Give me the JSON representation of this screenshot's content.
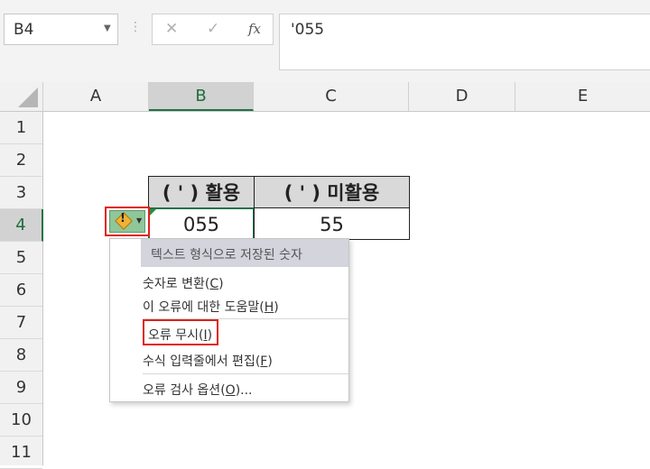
{
  "name_box": {
    "value": "B4"
  },
  "formula_bar": {
    "cancel_symbol": "✕",
    "enter_symbol": "✓",
    "fx_label": "fx",
    "content": "'055"
  },
  "columns": [
    "A",
    "B",
    "C",
    "D",
    "E"
  ],
  "rows": [
    "1",
    "2",
    "3",
    "4",
    "5",
    "6",
    "7",
    "8",
    "9",
    "10",
    "11"
  ],
  "selected_cell": {
    "column": "B",
    "row": "4"
  },
  "table": {
    "headers": [
      "( ' ) 활용",
      "( ' ) 미활용"
    ],
    "values": [
      "055",
      "55"
    ]
  },
  "error_menu": {
    "title": "텍스트 형식으로 저장된 숫자",
    "items": [
      {
        "label": "숫자로 변환",
        "key": "C"
      },
      {
        "label": "이 오류에 대한 도움말",
        "key": "H"
      },
      {
        "label": "오류 무시",
        "key": "I"
      },
      {
        "label": "수식 입력줄에서 편집",
        "key": "F"
      },
      {
        "label": "오류 검사 옵션",
        "key": "O",
        "suffix": "..."
      }
    ]
  },
  "colors": {
    "selection_green": "#217346",
    "highlight_red": "#e0201b",
    "header_fill": "#d9d9d9"
  }
}
